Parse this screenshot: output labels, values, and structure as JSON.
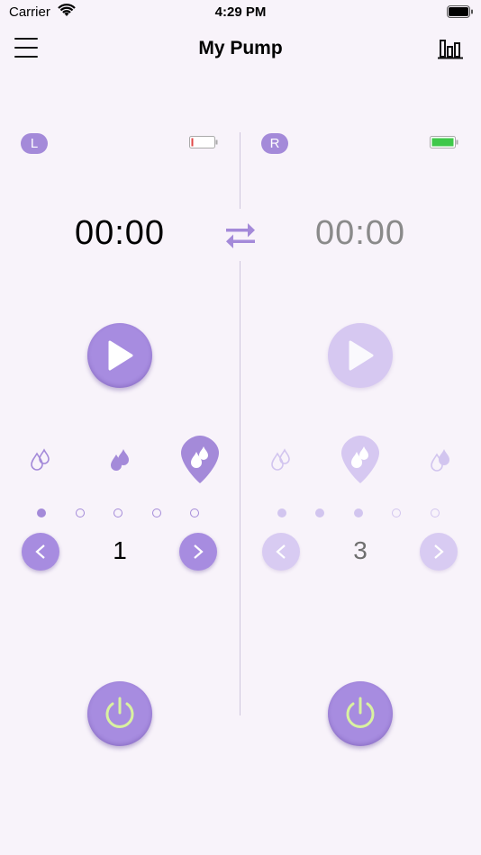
{
  "status_bar": {
    "carrier": "Carrier",
    "time": "4:29 PM"
  },
  "nav": {
    "title": "My Pump",
    "menu_icon": "hamburger-menu-icon",
    "stats_icon": "bar-chart-icon"
  },
  "left": {
    "side_label": "L",
    "battery_level": "low",
    "battery_color": "#e04848",
    "timer": "00:00",
    "play_icon": "play-icon",
    "modes": [
      "light-flow",
      "medium-flow",
      "strong-flow"
    ],
    "selected_mode": 2,
    "level_dots_filled": 1,
    "level_dots_total": 5,
    "level": "1"
  },
  "right": {
    "side_label": "R",
    "battery_level": "full",
    "battery_color": "#3fc84a",
    "timer": "00:00",
    "play_icon": "play-icon",
    "modes": [
      "light-flow",
      "strong-flow",
      "medium-flow"
    ],
    "selected_mode": 1,
    "level_dots_filled": 3,
    "level_dots_total": 5,
    "level": "3"
  },
  "colors": {
    "accent": "#a48ad9",
    "accent_light": "#d6c8f1",
    "power_ring": "#d9f2a0",
    "background": "#f8f3fa"
  }
}
